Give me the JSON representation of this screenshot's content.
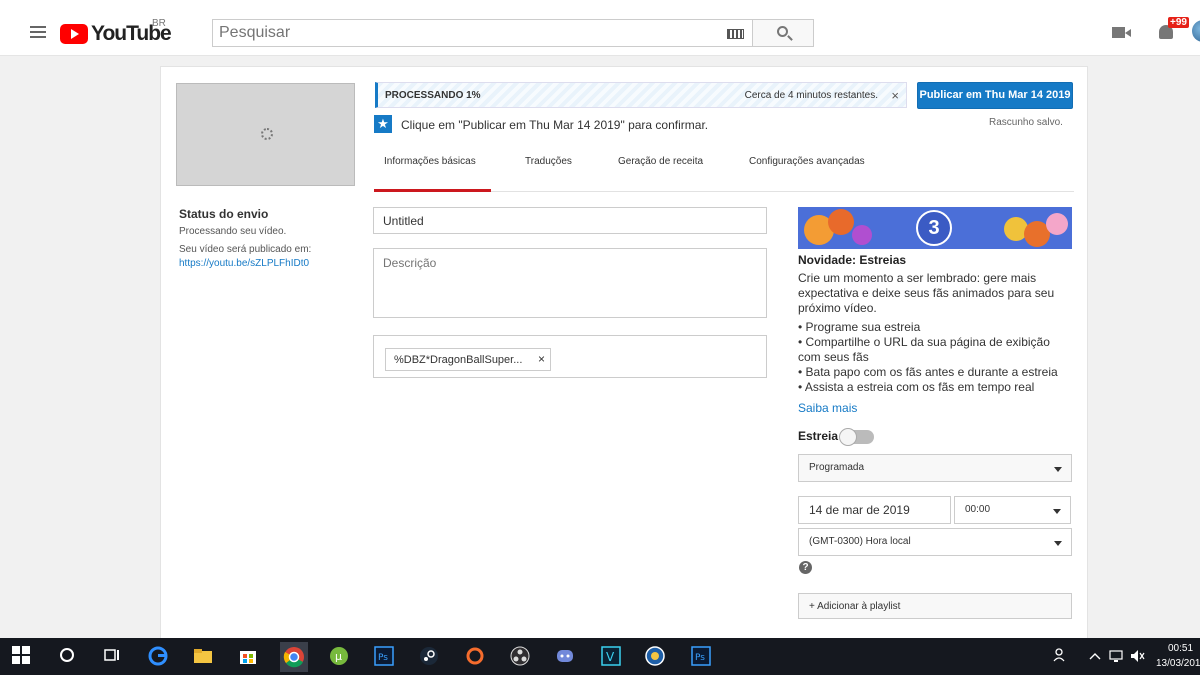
{
  "header": {
    "logo_text": "YouTube",
    "region": "BR",
    "search_placeholder": "Pesquisar",
    "notifications": "+99"
  },
  "sidebar": {
    "status_title": "Status do envio",
    "status_text": "Processando seu vídeo.",
    "publish_info": "Seu vídeo será publicado em:",
    "video_url": "https://youtu.be/sZLPLFhIDt0"
  },
  "processing": {
    "label": "PROCESSANDO 1%",
    "percent": 1,
    "remaining": "Cerca de 4 minutos restantes.",
    "close": "×"
  },
  "publish_button": "Publicar em Thu Mar 14 2019",
  "confirm_text": "Clique em \"Publicar em Thu Mar 14 2019\" para confirmar.",
  "draft_saved": "Rascunho salvo.",
  "tabs": [
    {
      "label": "Informações básicas",
      "active": true
    },
    {
      "label": "Traduções",
      "active": false
    },
    {
      "label": "Geração de receita",
      "active": false
    },
    {
      "label": "Configurações avançadas",
      "active": false
    }
  ],
  "form": {
    "title_value": "Untitled",
    "description_placeholder": "Descrição",
    "tag": "%DBZ*DragonBallSuper...",
    "tag_remove": "×"
  },
  "premiere": {
    "badge_number": "3",
    "title": "Novidade: Estreias",
    "description": "Crie um momento a ser lembrado: gere mais expectativa e deixe seus fãs animados para seu próximo vídeo.",
    "bullets": [
      "• Programe sua estreia",
      "• Compartilhe o URL da sua página de exibição com seus fãs",
      "• Bata papo com os fãs antes e durante a estreia",
      "• Assista a estreia com os fãs em tempo real"
    ],
    "learn_more": "Saiba mais",
    "toggle_label": "Estreia",
    "toggle_on": false,
    "visibility": "Programada",
    "date": "14 de mar de 2019",
    "time": "00:00",
    "timezone": "(GMT-0300) Hora local",
    "help": "?",
    "add_playlist": "+ Adicionar à playlist"
  },
  "taskbar": {
    "time": "00:51",
    "date": "13/03/2019"
  },
  "colors": {
    "accent": "#167ac6",
    "brand": "#ff0000",
    "tab_active": "#cc181e",
    "badge": "#e62117"
  }
}
